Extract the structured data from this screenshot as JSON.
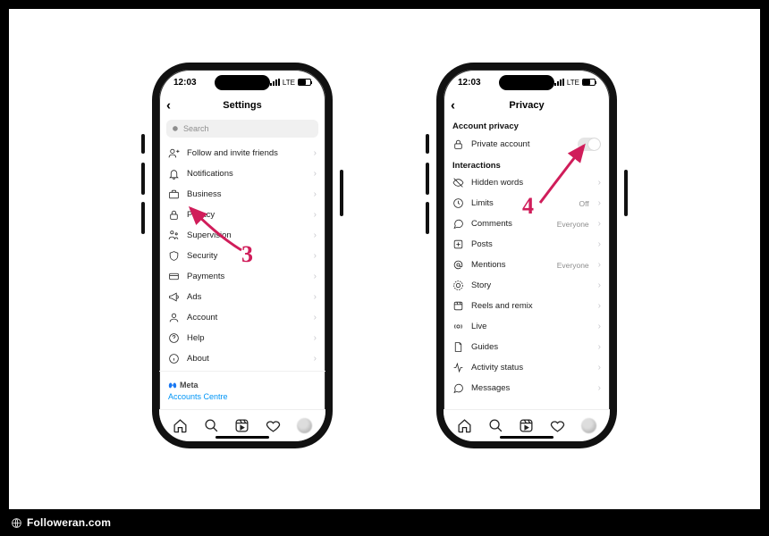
{
  "status": {
    "time": "12:03",
    "carrier": "LTE"
  },
  "watermark": "Followeran.com",
  "annotations": {
    "left": "3",
    "right": "4"
  },
  "phones": {
    "settings": {
      "title": "Settings",
      "search_placeholder": "Search",
      "items": [
        {
          "icon": "user-plus",
          "label": "Follow and invite friends"
        },
        {
          "icon": "bell",
          "label": "Notifications"
        },
        {
          "icon": "briefcase",
          "label": "Business"
        },
        {
          "icon": "lock",
          "label": "Privacy"
        },
        {
          "icon": "family",
          "label": "Supervision"
        },
        {
          "icon": "shield",
          "label": "Security"
        },
        {
          "icon": "card",
          "label": "Payments"
        },
        {
          "icon": "megaphone",
          "label": "Ads"
        },
        {
          "icon": "user",
          "label": "Account"
        },
        {
          "icon": "help",
          "label": "Help"
        },
        {
          "icon": "info",
          "label": "About"
        }
      ],
      "meta": {
        "brand": "Meta",
        "link": "Accounts Centre"
      }
    },
    "privacy": {
      "title": "Privacy",
      "sections": {
        "account": {
          "header": "Account privacy",
          "item": {
            "icon": "lock",
            "label": "Private account",
            "toggled": false
          }
        },
        "interactions": {
          "header": "Interactions",
          "items": [
            {
              "icon": "hidden",
              "label": "Hidden words",
              "value": ""
            },
            {
              "icon": "limits",
              "label": "Limits",
              "value": "Off"
            },
            {
              "icon": "comment",
              "label": "Comments",
              "value": "Everyone"
            },
            {
              "icon": "plus-sq",
              "label": "Posts",
              "value": ""
            },
            {
              "icon": "at",
              "label": "Mentions",
              "value": "Everyone"
            },
            {
              "icon": "story",
              "label": "Story",
              "value": ""
            },
            {
              "icon": "reels",
              "label": "Reels and remix",
              "value": ""
            },
            {
              "icon": "live",
              "label": "Live",
              "value": ""
            },
            {
              "icon": "guides",
              "label": "Guides",
              "value": ""
            },
            {
              "icon": "activity",
              "label": "Activity status",
              "value": ""
            },
            {
              "icon": "message",
              "label": "Messages",
              "value": ""
            }
          ]
        }
      }
    }
  },
  "tabs": [
    "home",
    "search",
    "reels",
    "heart",
    "profile"
  ]
}
